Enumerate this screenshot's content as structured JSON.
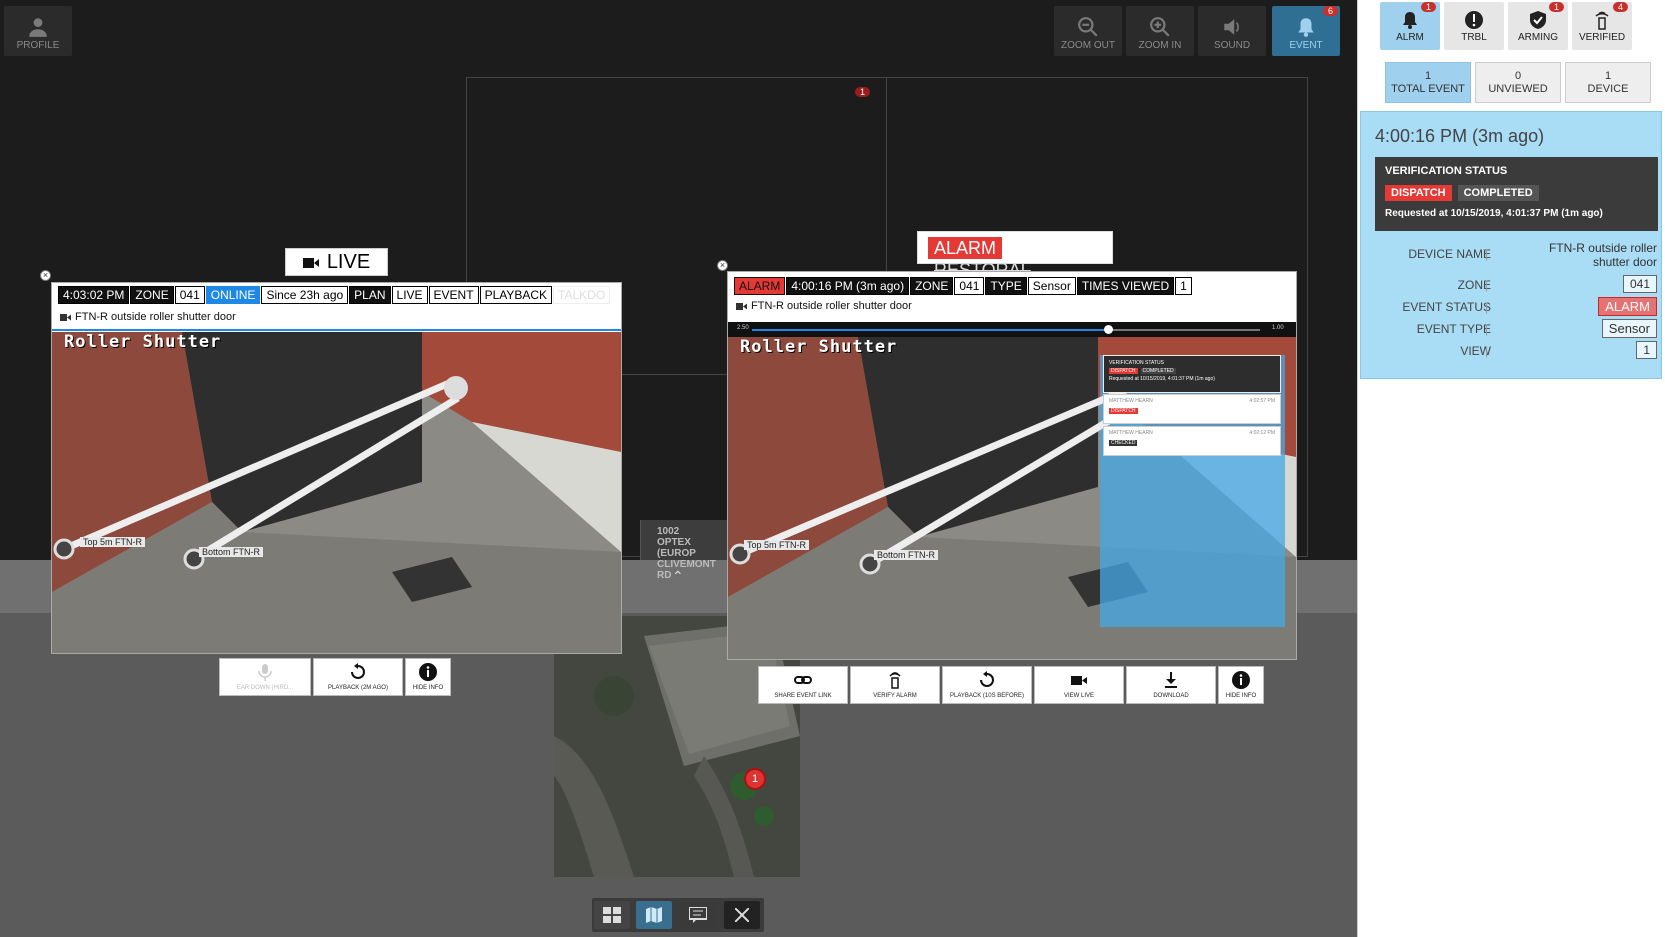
{
  "topbar": {
    "profile_label": "PROFILE",
    "zoom_out_label": "ZOOM OUT",
    "zoom_in_label": "ZOOM IN",
    "sound_label": "SOUND",
    "event_label": "EVENT",
    "event_badge": "6"
  },
  "grid": {
    "cell_badge": "1"
  },
  "map": {
    "device_number": "1002",
    "device_line1": "OPTEX (EUROP",
    "device_line2": "CLIVEMONT RD",
    "pin_label": "1"
  },
  "live_window": {
    "header_label": "LIVE",
    "tags": {
      "time": "4:03:02 PM",
      "zone": "ZONE",
      "zone_value": "041",
      "online": "ONLINE",
      "since": "Since 23h ago",
      "plan": "PLAN",
      "live": "LIVE",
      "event": "EVENT",
      "playback": "PLAYBACK",
      "talkdown": "TALKDO"
    },
    "device_name": "FTN-R outside roller shutter door",
    "camera_caption": "Roller Shutter",
    "marker_top": "Top 5m FTN-R",
    "marker_bottom": "Bottom FTN-R",
    "buttons": {
      "talk": "EAR DOWN (HIRD...",
      "playback": "PLAYBACK (2M AGO)",
      "hide": "HIDE INFO"
    }
  },
  "alarm_window": {
    "header_alarm": "ALARM",
    "header_restoral": "RESTORAL",
    "tags": {
      "alarm": "ALARM",
      "time": "4:00:16 PM (3m ago)",
      "zone": "ZONE",
      "zone_value": "041",
      "type": "TYPE",
      "type_value": "Sensor",
      "views": "TIMES VIEWED",
      "views_value": "1"
    },
    "device_name": "FTN-R outside roller shutter door",
    "scrub_start": "2.50",
    "scrub_end": "1.00",
    "scrub_progress": 0.7,
    "camera_caption": "Roller Shutter",
    "marker_top": "Top 5m FTN-R",
    "marker_bottom": "Bottom FTN-R",
    "overlay": {
      "title": "VERIFICATION STATUS",
      "dispatch": "DISPATCH",
      "completed": "COMPLETED",
      "requested": "Requested at 10/15/2019, 4:01:37 PM (1m ago)",
      "log": [
        {
          "user": "MATTHEW HEARN",
          "time": "4:02:57 PM",
          "status": "DISPATCH"
        },
        {
          "user": "MATTHEW HEARN",
          "time": "4:02:12 PM",
          "status": "CHECKED"
        }
      ]
    },
    "buttons": {
      "share": "SHARE EVENT LINK",
      "verify": "VERIFY ALARM",
      "playback": "PLAYBACK (10S BEFORE)",
      "view_live": "VIEW LIVE",
      "download": "DOWNLOAD",
      "hide": "HIDE INFO"
    }
  },
  "right_panel": {
    "tabs": [
      {
        "label": "ALRM",
        "badge": "1"
      },
      {
        "label": "TRBL",
        "badge": ""
      },
      {
        "label": "ARMING",
        "badge": "1"
      },
      {
        "label": "VERIFIED",
        "badge": "4"
      }
    ],
    "counters": [
      {
        "value": "1",
        "label": "TOTAL EVENT"
      },
      {
        "value": "0",
        "label": "UNVIEWED"
      },
      {
        "value": "1",
        "label": "DEVICE"
      }
    ],
    "event_time": "4:00:16 PM (3m ago)",
    "verification": {
      "title": "VERIFICATION STATUS",
      "dispatch": "DISPATCH",
      "completed": "COMPLETED",
      "requested": "Requested at 10/15/2019, 4:01:37 PM (1m ago)"
    },
    "details": {
      "device_name_label": "DEVICE NAME",
      "device_name_value": "FTN-R outside roller shutter door",
      "zone_label": "ZONE",
      "zone_value": "041",
      "event_status_label": "EVENT STATUS",
      "event_status_value": "ALARM",
      "event_type_label": "EVENT TYPE",
      "event_type_value": "Sensor",
      "view_label": "VIEW",
      "view_value": "1"
    }
  },
  "colors": {
    "accent_blue": "#9fd0ee",
    "alarm_red": "#e53935",
    "online_blue": "#1e88e5",
    "badge_red": "#c9302c"
  }
}
